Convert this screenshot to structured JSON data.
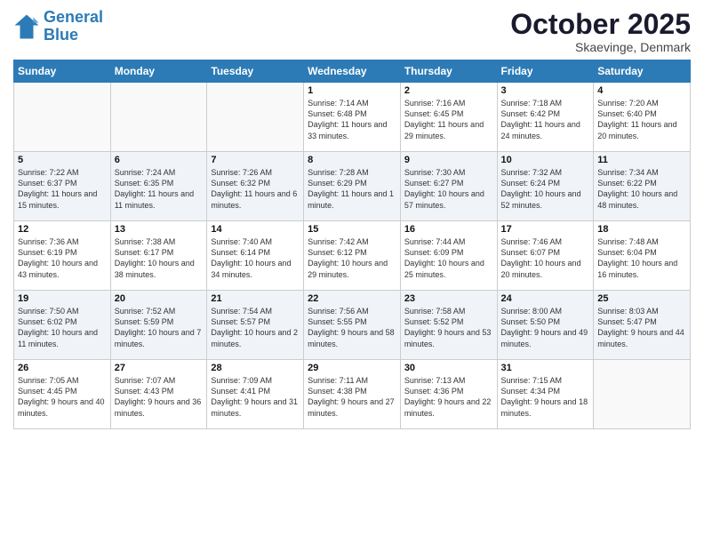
{
  "header": {
    "logo_line1": "General",
    "logo_line2": "Blue",
    "month": "October 2025",
    "location": "Skaevinge, Denmark"
  },
  "weekdays": [
    "Sunday",
    "Monday",
    "Tuesday",
    "Wednesday",
    "Thursday",
    "Friday",
    "Saturday"
  ],
  "weeks": [
    [
      {
        "day": "",
        "sunrise": "",
        "sunset": "",
        "daylight": "",
        "empty": true
      },
      {
        "day": "",
        "sunrise": "",
        "sunset": "",
        "daylight": "",
        "empty": true
      },
      {
        "day": "",
        "sunrise": "",
        "sunset": "",
        "daylight": "",
        "empty": true
      },
      {
        "day": "1",
        "sunrise": "Sunrise: 7:14 AM",
        "sunset": "Sunset: 6:48 PM",
        "daylight": "Daylight: 11 hours and 33 minutes.",
        "empty": false
      },
      {
        "day": "2",
        "sunrise": "Sunrise: 7:16 AM",
        "sunset": "Sunset: 6:45 PM",
        "daylight": "Daylight: 11 hours and 29 minutes.",
        "empty": false
      },
      {
        "day": "3",
        "sunrise": "Sunrise: 7:18 AM",
        "sunset": "Sunset: 6:42 PM",
        "daylight": "Daylight: 11 hours and 24 minutes.",
        "empty": false
      },
      {
        "day": "4",
        "sunrise": "Sunrise: 7:20 AM",
        "sunset": "Sunset: 6:40 PM",
        "daylight": "Daylight: 11 hours and 20 minutes.",
        "empty": false
      }
    ],
    [
      {
        "day": "5",
        "sunrise": "Sunrise: 7:22 AM",
        "sunset": "Sunset: 6:37 PM",
        "daylight": "Daylight: 11 hours and 15 minutes.",
        "empty": false
      },
      {
        "day": "6",
        "sunrise": "Sunrise: 7:24 AM",
        "sunset": "Sunset: 6:35 PM",
        "daylight": "Daylight: 11 hours and 11 minutes.",
        "empty": false
      },
      {
        "day": "7",
        "sunrise": "Sunrise: 7:26 AM",
        "sunset": "Sunset: 6:32 PM",
        "daylight": "Daylight: 11 hours and 6 minutes.",
        "empty": false
      },
      {
        "day": "8",
        "sunrise": "Sunrise: 7:28 AM",
        "sunset": "Sunset: 6:29 PM",
        "daylight": "Daylight: 11 hours and 1 minute.",
        "empty": false
      },
      {
        "day": "9",
        "sunrise": "Sunrise: 7:30 AM",
        "sunset": "Sunset: 6:27 PM",
        "daylight": "Daylight: 10 hours and 57 minutes.",
        "empty": false
      },
      {
        "day": "10",
        "sunrise": "Sunrise: 7:32 AM",
        "sunset": "Sunset: 6:24 PM",
        "daylight": "Daylight: 10 hours and 52 minutes.",
        "empty": false
      },
      {
        "day": "11",
        "sunrise": "Sunrise: 7:34 AM",
        "sunset": "Sunset: 6:22 PM",
        "daylight": "Daylight: 10 hours and 48 minutes.",
        "empty": false
      }
    ],
    [
      {
        "day": "12",
        "sunrise": "Sunrise: 7:36 AM",
        "sunset": "Sunset: 6:19 PM",
        "daylight": "Daylight: 10 hours and 43 minutes.",
        "empty": false
      },
      {
        "day": "13",
        "sunrise": "Sunrise: 7:38 AM",
        "sunset": "Sunset: 6:17 PM",
        "daylight": "Daylight: 10 hours and 38 minutes.",
        "empty": false
      },
      {
        "day": "14",
        "sunrise": "Sunrise: 7:40 AM",
        "sunset": "Sunset: 6:14 PM",
        "daylight": "Daylight: 10 hours and 34 minutes.",
        "empty": false
      },
      {
        "day": "15",
        "sunrise": "Sunrise: 7:42 AM",
        "sunset": "Sunset: 6:12 PM",
        "daylight": "Daylight: 10 hours and 29 minutes.",
        "empty": false
      },
      {
        "day": "16",
        "sunrise": "Sunrise: 7:44 AM",
        "sunset": "Sunset: 6:09 PM",
        "daylight": "Daylight: 10 hours and 25 minutes.",
        "empty": false
      },
      {
        "day": "17",
        "sunrise": "Sunrise: 7:46 AM",
        "sunset": "Sunset: 6:07 PM",
        "daylight": "Daylight: 10 hours and 20 minutes.",
        "empty": false
      },
      {
        "day": "18",
        "sunrise": "Sunrise: 7:48 AM",
        "sunset": "Sunset: 6:04 PM",
        "daylight": "Daylight: 10 hours and 16 minutes.",
        "empty": false
      }
    ],
    [
      {
        "day": "19",
        "sunrise": "Sunrise: 7:50 AM",
        "sunset": "Sunset: 6:02 PM",
        "daylight": "Daylight: 10 hours and 11 minutes.",
        "empty": false
      },
      {
        "day": "20",
        "sunrise": "Sunrise: 7:52 AM",
        "sunset": "Sunset: 5:59 PM",
        "daylight": "Daylight: 10 hours and 7 minutes.",
        "empty": false
      },
      {
        "day": "21",
        "sunrise": "Sunrise: 7:54 AM",
        "sunset": "Sunset: 5:57 PM",
        "daylight": "Daylight: 10 hours and 2 minutes.",
        "empty": false
      },
      {
        "day": "22",
        "sunrise": "Sunrise: 7:56 AM",
        "sunset": "Sunset: 5:55 PM",
        "daylight": "Daylight: 9 hours and 58 minutes.",
        "empty": false
      },
      {
        "day": "23",
        "sunrise": "Sunrise: 7:58 AM",
        "sunset": "Sunset: 5:52 PM",
        "daylight": "Daylight: 9 hours and 53 minutes.",
        "empty": false
      },
      {
        "day": "24",
        "sunrise": "Sunrise: 8:00 AM",
        "sunset": "Sunset: 5:50 PM",
        "daylight": "Daylight: 9 hours and 49 minutes.",
        "empty": false
      },
      {
        "day": "25",
        "sunrise": "Sunrise: 8:03 AM",
        "sunset": "Sunset: 5:47 PM",
        "daylight": "Daylight: 9 hours and 44 minutes.",
        "empty": false
      }
    ],
    [
      {
        "day": "26",
        "sunrise": "Sunrise: 7:05 AM",
        "sunset": "Sunset: 4:45 PM",
        "daylight": "Daylight: 9 hours and 40 minutes.",
        "empty": false
      },
      {
        "day": "27",
        "sunrise": "Sunrise: 7:07 AM",
        "sunset": "Sunset: 4:43 PM",
        "daylight": "Daylight: 9 hours and 36 minutes.",
        "empty": false
      },
      {
        "day": "28",
        "sunrise": "Sunrise: 7:09 AM",
        "sunset": "Sunset: 4:41 PM",
        "daylight": "Daylight: 9 hours and 31 minutes.",
        "empty": false
      },
      {
        "day": "29",
        "sunrise": "Sunrise: 7:11 AM",
        "sunset": "Sunset: 4:38 PM",
        "daylight": "Daylight: 9 hours and 27 minutes.",
        "empty": false
      },
      {
        "day": "30",
        "sunrise": "Sunrise: 7:13 AM",
        "sunset": "Sunset: 4:36 PM",
        "daylight": "Daylight: 9 hours and 22 minutes.",
        "empty": false
      },
      {
        "day": "31",
        "sunrise": "Sunrise: 7:15 AM",
        "sunset": "Sunset: 4:34 PM",
        "daylight": "Daylight: 9 hours and 18 minutes.",
        "empty": false
      },
      {
        "day": "",
        "sunrise": "",
        "sunset": "",
        "daylight": "",
        "empty": true
      }
    ]
  ]
}
